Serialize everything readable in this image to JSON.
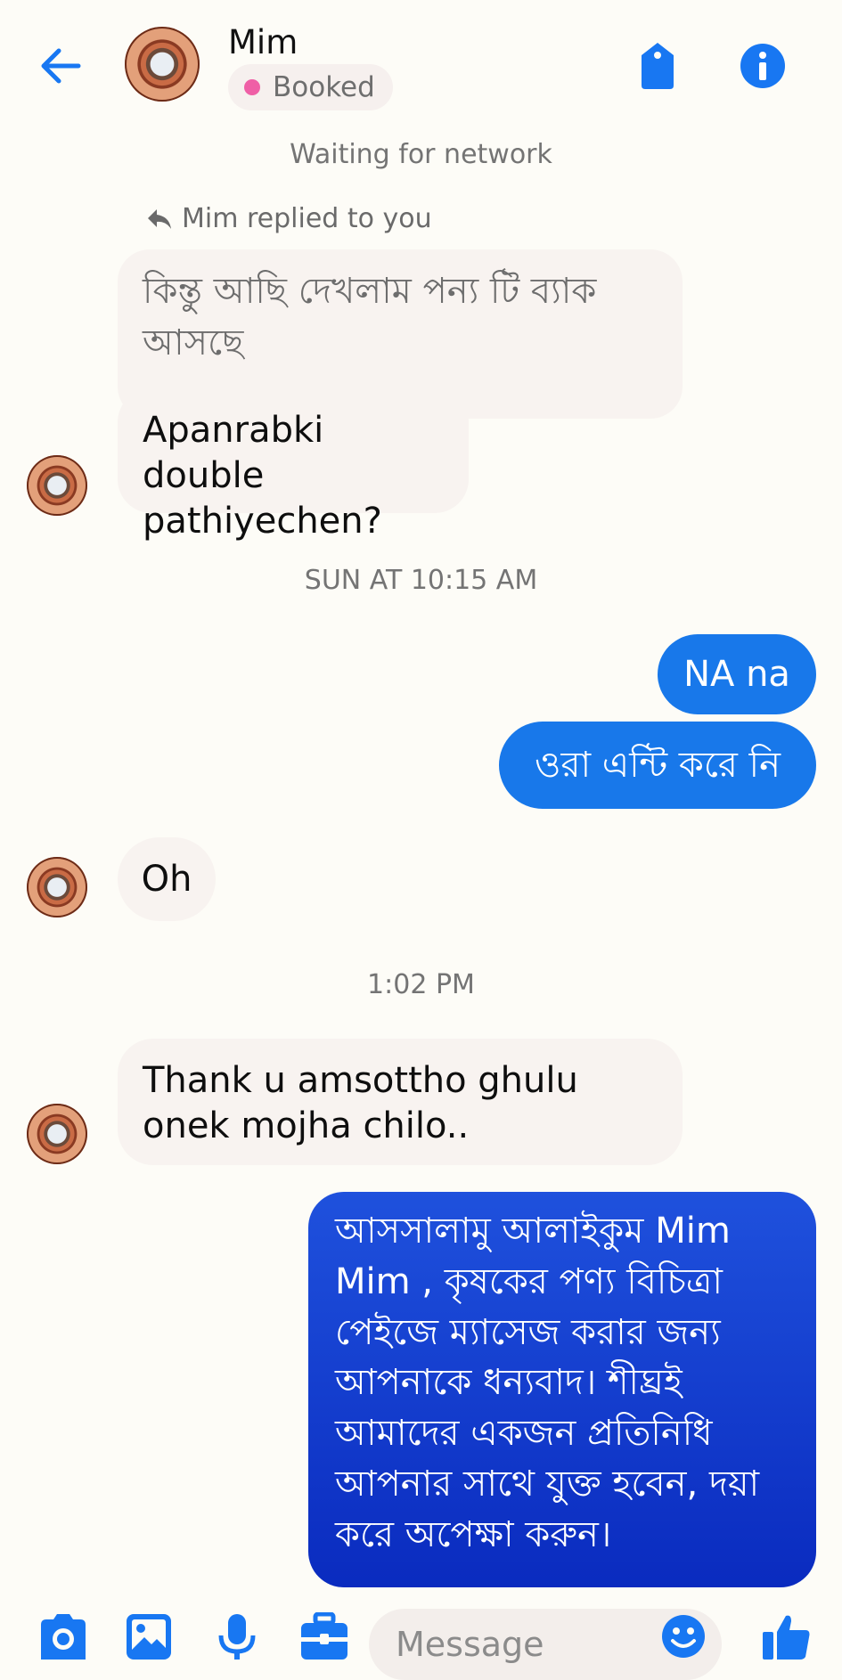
{
  "header": {
    "contact_name": "Mim",
    "status_label": "Booked",
    "colors": {
      "accent": "#1877f2",
      "status_dot": "#ef5fa6"
    }
  },
  "network_status": "Waiting for network",
  "reply_note": "Mim replied to you",
  "messages": [
    {
      "from": "contact",
      "text": "কিন্তু আছি দেখলাম পন্য টি ব্যাক আসছে",
      "quoted": true
    },
    {
      "from": "contact",
      "text": "Apanrabki double pathiyechen?"
    },
    {
      "type": "timestamp",
      "text": "SUN AT 10:15 AM"
    },
    {
      "from": "me",
      "text": "NA na"
    },
    {
      "from": "me",
      "text": "ওরা এন্টি করে নি"
    },
    {
      "from": "contact",
      "text": "Oh"
    },
    {
      "type": "timestamp",
      "text": "1:02 PM"
    },
    {
      "from": "contact",
      "text": "Thank u amsottho ghulu onek mojha chilo.."
    },
    {
      "from": "me",
      "text": "আসসালামু আলাইকুম Mim Mim , কৃষকের পণ্য বিচিত্রা পেইজে ম্যাসেজ করার জন্য আপনাকে ধন্যবাদ। শীঘ্রই আমাদের একজন প্রতিনিধি আপনার সাথে যুক্ত হবেন, দয়া করে অপেক্ষা করুন।"
    }
  ],
  "composer": {
    "placeholder": "Message",
    "icons": [
      "camera-icon",
      "gallery-icon",
      "microphone-icon",
      "briefcase-icon",
      "emoji-icon",
      "like-icon"
    ]
  }
}
